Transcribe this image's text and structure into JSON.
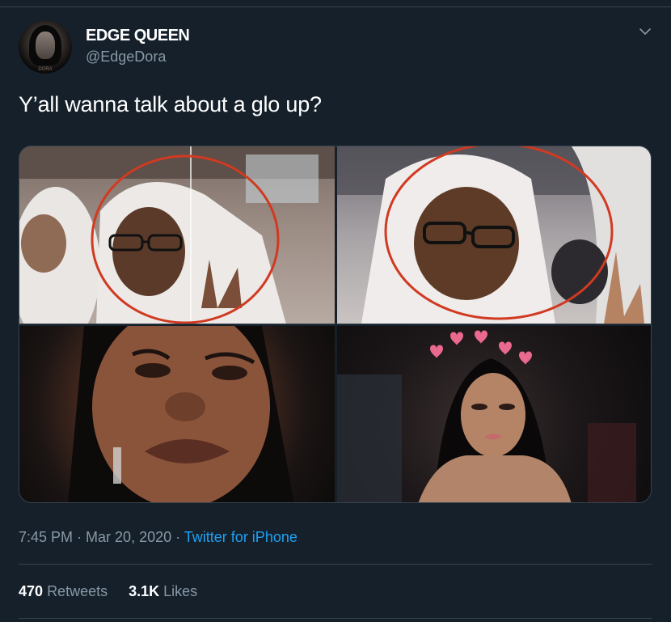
{
  "user": {
    "display_name": "EDGE QUEEN",
    "handle": "@EdgeDora",
    "avatar_icon": "profile-photo",
    "avatar_caption": "DORA"
  },
  "tweet": {
    "text": "Y’all wanna talk about a glo up?"
  },
  "meta": {
    "time": "7:45 PM",
    "separator": " · ",
    "date": "Mar 20, 2020",
    "source": "Twitter for iPhone"
  },
  "stats": {
    "retweets_count": "470",
    "retweets_label": "Retweets",
    "likes_count": "3.1K",
    "likes_label": "Likes"
  },
  "colors": {
    "background": "#15202b",
    "muted_text": "#8899a6",
    "link": "#1da1f2",
    "border": "#38444d",
    "circle_annotation": "#d03a21",
    "hearts": "#e9698f"
  }
}
